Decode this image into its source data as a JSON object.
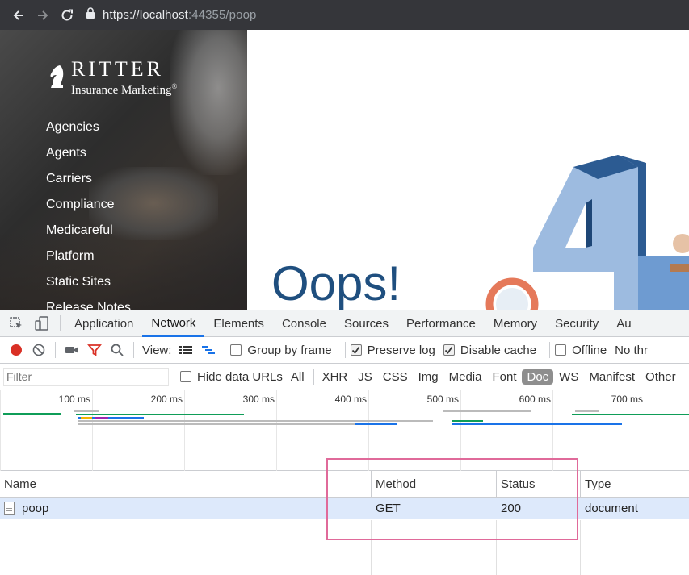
{
  "browser": {
    "url_host": "https://localhost",
    "url_port_path": ":44355/poop"
  },
  "site": {
    "logo_title": "RITTER",
    "logo_subtitle": "Insurance Marketing",
    "logo_mark": "®",
    "menu": [
      "Agencies",
      "Agents",
      "Carriers",
      "Compliance",
      "Medicareful",
      "Platform",
      "Static Sites",
      "Release Notes"
    ],
    "headline": "Oops!",
    "accent_color": "#1f4f7f"
  },
  "devtools": {
    "tabs": [
      "Application",
      "Network",
      "Elements",
      "Console",
      "Sources",
      "Performance",
      "Memory",
      "Security",
      "Au"
    ],
    "active_tab": "Network",
    "toolbar": {
      "view_label": "View:",
      "group_by_frame": "Group by frame",
      "preserve_log": "Preserve log",
      "disable_cache": "Disable cache",
      "offline": "Offline",
      "throttle": "No thr"
    },
    "filter": {
      "placeholder": "Filter",
      "hide_data_urls": "Hide data URLs",
      "types": [
        "All",
        "XHR",
        "JS",
        "CSS",
        "Img",
        "Media",
        "Font",
        "Doc",
        "WS",
        "Manifest",
        "Other"
      ],
      "active_type": "Doc"
    },
    "overview_ticks": [
      "100 ms",
      "200 ms",
      "300 ms",
      "400 ms",
      "500 ms",
      "600 ms",
      "700 ms"
    ],
    "columns": [
      "Name",
      "Method",
      "Status",
      "Type"
    ],
    "rows": [
      {
        "name": "poop",
        "method": "GET",
        "status": "200",
        "type": "document"
      }
    ],
    "highlight_color": "#e06a9a"
  }
}
